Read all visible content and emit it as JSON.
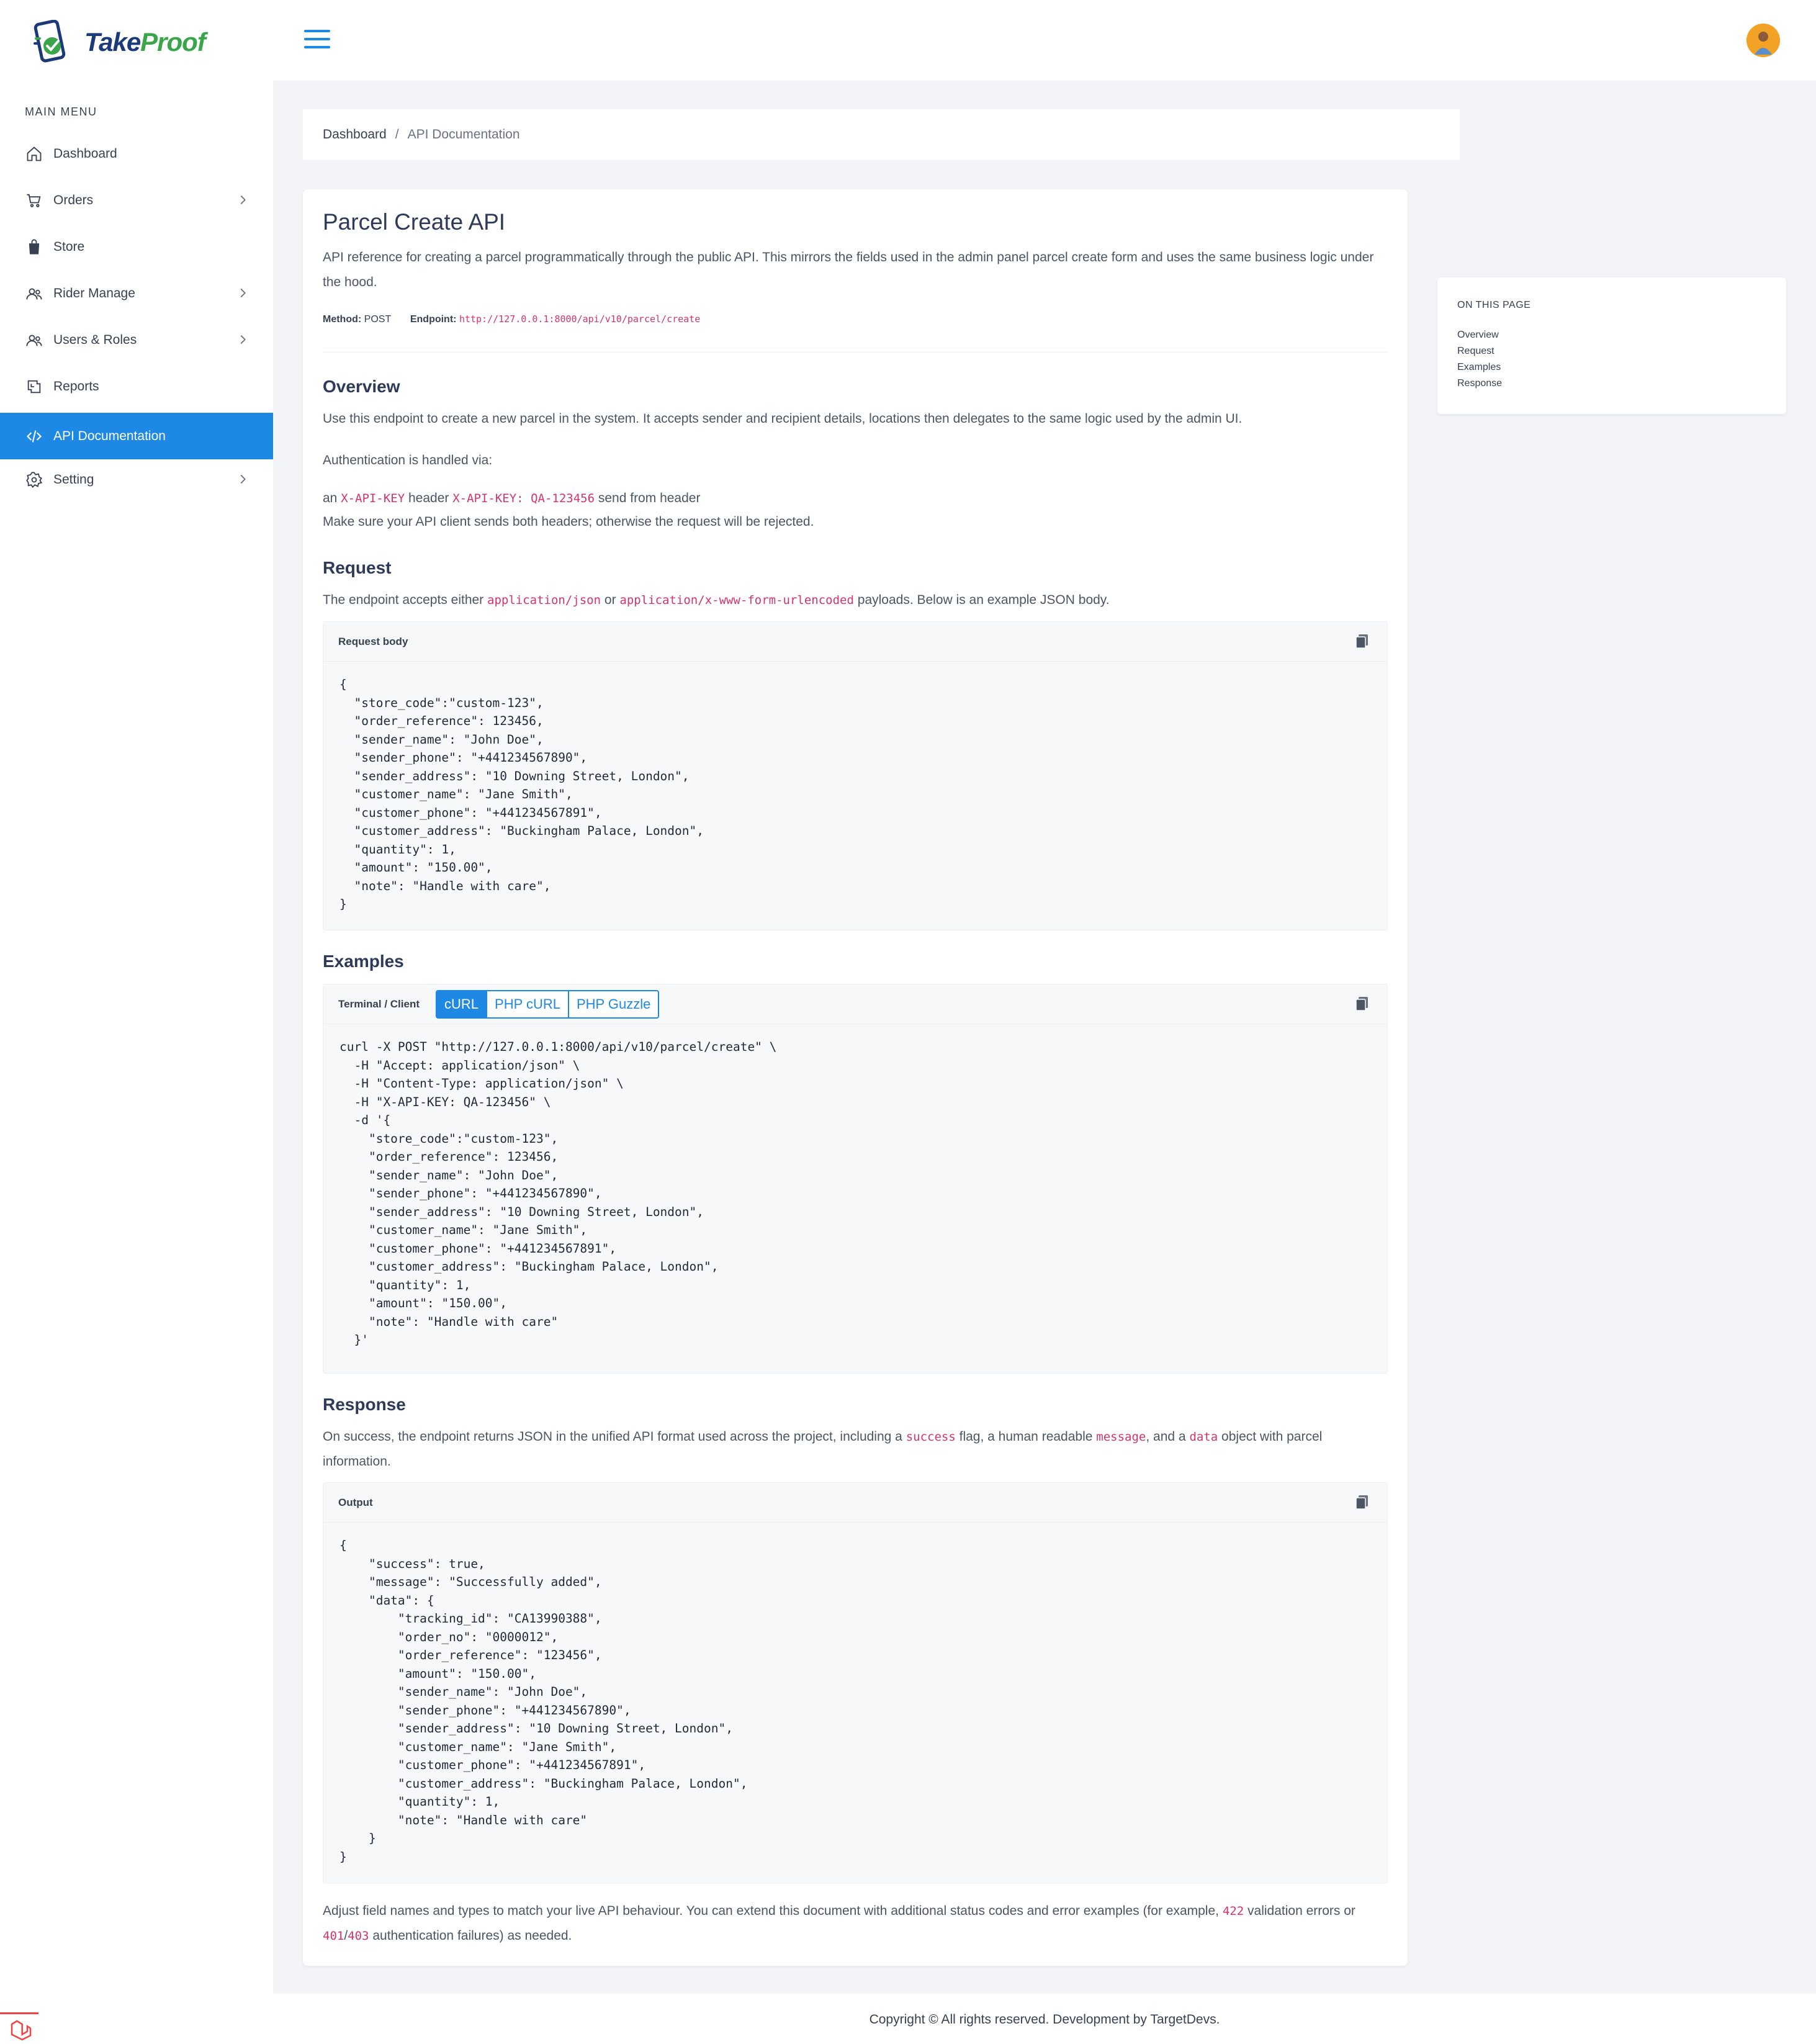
{
  "app": {
    "brand_part1": "Take",
    "brand_part2": "Proof"
  },
  "sidebar": {
    "menu_title": "MAIN MENU",
    "items": [
      {
        "label": "Dashboard",
        "icon": "home-icon",
        "has_chevron": false
      },
      {
        "label": "Orders",
        "icon": "cart-icon",
        "has_chevron": true
      },
      {
        "label": "Store",
        "icon": "shopping-bag-icon",
        "has_chevron": false
      },
      {
        "label": "Rider Manage",
        "icon": "users-icon",
        "has_chevron": true
      },
      {
        "label": "Users & Roles",
        "icon": "users-icon",
        "has_chevron": true
      },
      {
        "label": "Reports",
        "icon": "chart-icon",
        "has_chevron": false
      },
      {
        "label": "API Documentation",
        "icon": "code-icon",
        "has_chevron": false,
        "active": true
      },
      {
        "label": "Setting",
        "icon": "gear-icon",
        "has_chevron": true
      }
    ]
  },
  "breadcrumb": {
    "home": "Dashboard",
    "separator": "/",
    "current": "API Documentation"
  },
  "doc": {
    "title": "Parcel Create API",
    "intro": "API reference for creating a parcel programmatically through the public API. This mirrors the fields used in the admin panel parcel create form and uses the same business logic under the hood.",
    "method_label": "Method:",
    "method_value": "POST",
    "endpoint_label": "Endpoint:",
    "endpoint_value": "http://127.0.0.1:8000/api/v10/parcel/create",
    "overview": {
      "heading": "Overview",
      "text": "Use this endpoint to create a new parcel in the system. It accepts sender and recipient details, locations then delegates to the same logic used by the admin UI.",
      "auth_intro": "Authentication is handled via:",
      "auth_prefix": "an",
      "auth_header_code": "X-API-KEY",
      "auth_middle": "header",
      "auth_example_code": "X-API-KEY: QA-123456",
      "auth_suffix": "send from header",
      "auth_note": "Make sure your API client sends both headers; otherwise the request will be rejected."
    },
    "request": {
      "heading": "Request",
      "text_prefix": "The endpoint accepts either",
      "type1": "application/json",
      "text_or": "or",
      "type2": "application/x-www-form-urlencoded",
      "text_suffix": "payloads. Below is an example JSON body.",
      "block_title": "Request body",
      "code": "{\n  \"store_code\":\"custom-123\",\n  \"order_reference\": 123456,\n  \"sender_name\": \"John Doe\",\n  \"sender_phone\": \"+441234567890\",\n  \"sender_address\": \"10 Downing Street, London\",\n  \"customer_name\": \"Jane Smith\",\n  \"customer_phone\": \"+441234567891\",\n  \"customer_address\": \"Buckingham Palace, London\",\n  \"quantity\": 1,\n  \"amount\": \"150.00\",\n  \"note\": \"Handle with care\",\n}"
    },
    "examples": {
      "heading": "Examples",
      "block_title": "Terminal / Client",
      "tabs": [
        "cURL",
        "PHP cURL",
        "PHP Guzzle"
      ],
      "active_tab": "cURL",
      "code": "curl -X POST \"http://127.0.0.1:8000/api/v10/parcel/create\" \\\n  -H \"Accept: application/json\" \\\n  -H \"Content-Type: application/json\" \\\n  -H \"X-API-KEY: QA-123456\" \\\n  -d '{\n    \"store_code\":\"custom-123\",\n    \"order_reference\": 123456,\n    \"sender_name\": \"John Doe\",\n    \"sender_phone\": \"+441234567890\",\n    \"sender_address\": \"10 Downing Street, London\",\n    \"customer_name\": \"Jane Smith\",\n    \"customer_phone\": \"+441234567891\",\n    \"customer_address\": \"Buckingham Palace, London\",\n    \"quantity\": 1,\n    \"amount\": \"150.00\",\n    \"note\": \"Handle with care\"\n  }'"
    },
    "response": {
      "heading": "Response",
      "text_prefix": "On success, the endpoint returns JSON in the unified API format used across the project, including a",
      "code1": "success",
      "text_mid1": "flag, a human readable",
      "code2": "message",
      "text_mid2": ", and a",
      "code3": "data",
      "text_suffix": "object with parcel information.",
      "block_title": "Output",
      "code": "{\n    \"success\": true,\n    \"message\": \"Successfully added\",\n    \"data\": {\n        \"tracking_id\": \"CA13990388\",\n        \"order_no\": \"0000012\",\n        \"order_reference\": \"123456\",\n        \"amount\": \"150.00\",\n        \"sender_name\": \"John Doe\",\n        \"sender_phone\": \"+441234567890\",\n        \"sender_address\": \"10 Downing Street, London\",\n        \"customer_name\": \"Jane Smith\",\n        \"customer_phone\": \"+441234567891\",\n        \"customer_address\": \"Buckingham Palace, London\",\n        \"quantity\": 1,\n        \"note\": \"Handle with care\"\n    }\n}",
      "footer_prefix": "Adjust field names and types to match your live API behaviour. You can extend this document with additional status codes and error examples (for example,",
      "code_422": "422",
      "footer_mid": "validation errors or",
      "code_401": "401",
      "slash": "/",
      "code_403": "403",
      "footer_suffix": "authentication failures) as needed."
    }
  },
  "toc": {
    "title": "ON THIS PAGE",
    "links": [
      "Overview",
      "Request",
      "Examples",
      "Response"
    ]
  },
  "footer": {
    "text": "Copyright © All rights reserved. Development by TargetDevs."
  },
  "colors": {
    "accent": "#1e88e5",
    "code_inline": "#d6336c",
    "brand_dark": "#1c3a78",
    "brand_green": "#3aa54a"
  }
}
